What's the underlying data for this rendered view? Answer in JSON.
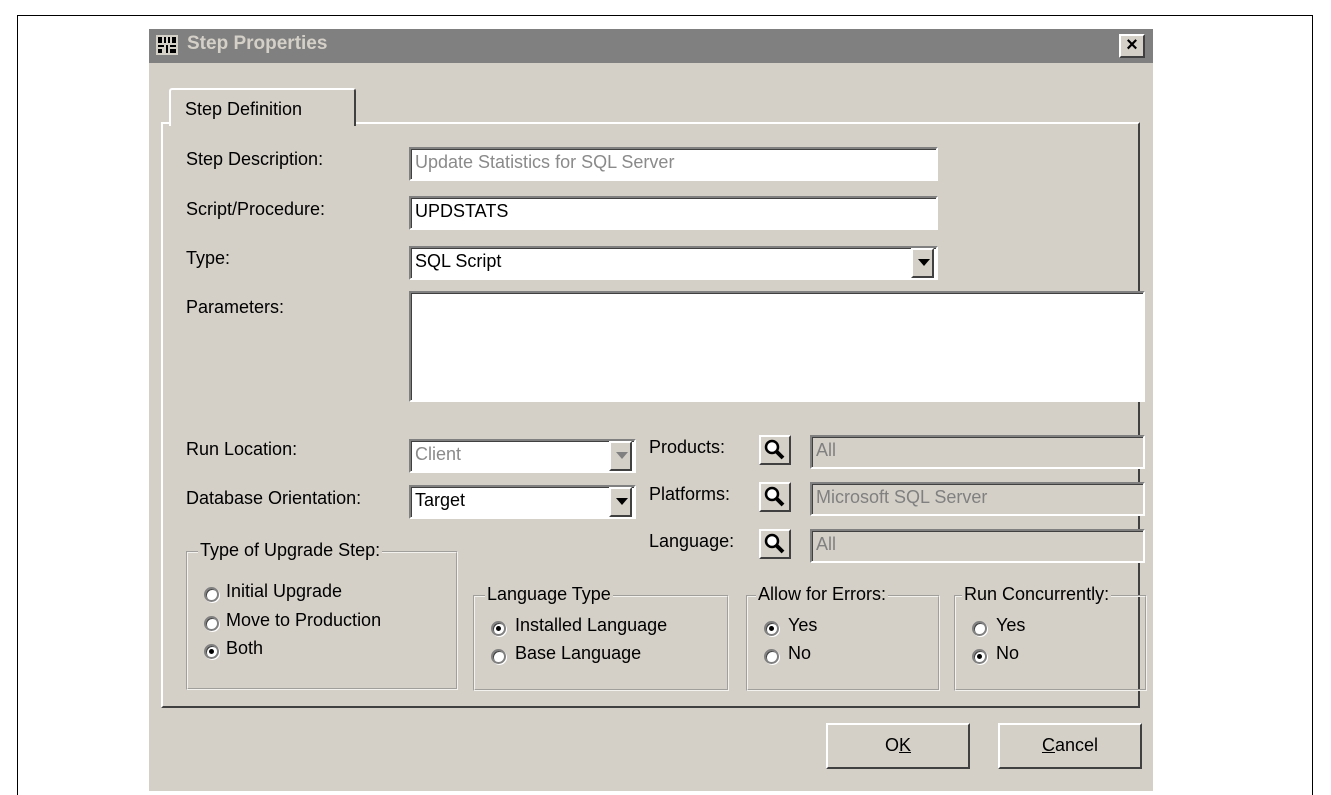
{
  "window": {
    "title": "Step Properties",
    "close_glyph": "×"
  },
  "tabs": [
    {
      "label": "Step Definition",
      "active": true
    }
  ],
  "fields": {
    "step_description": {
      "label": "Step Description:",
      "value": "Update Statistics for SQL Server"
    },
    "script_procedure": {
      "label": "Script/Procedure:",
      "value": "UPDSTATS"
    },
    "type": {
      "label": "Type:",
      "value": "SQL Script"
    },
    "parameters": {
      "label": "Parameters:",
      "value": ""
    },
    "run_location": {
      "label": "Run Location:",
      "value": "Client"
    },
    "database_orientation": {
      "label": "Database Orientation:",
      "value": "Target"
    },
    "products": {
      "label": "Products:",
      "value": "All"
    },
    "platforms": {
      "label": "Platforms:",
      "value": "Microsoft SQL Server"
    },
    "language": {
      "label": "Language:",
      "value": "All"
    }
  },
  "groups": {
    "upgrade_step": {
      "legend": "Type of Upgrade Step:",
      "options": [
        {
          "label": "Initial Upgrade",
          "checked": false
        },
        {
          "label": "Move to Production",
          "checked": false
        },
        {
          "label": "Both",
          "checked": true
        }
      ]
    },
    "language_type": {
      "legend": "Language Type",
      "options": [
        {
          "label": "Installed Language",
          "checked": true
        },
        {
          "label": "Base Language",
          "checked": false
        }
      ]
    },
    "allow_errors": {
      "legend": "Allow for Errors:",
      "options": [
        {
          "label": "Yes",
          "checked": true
        },
        {
          "label": "No",
          "checked": false
        }
      ]
    },
    "run_concurrently": {
      "legend": "Run Concurrently:",
      "options": [
        {
          "label": "Yes",
          "checked": false
        },
        {
          "label": "No",
          "checked": true
        }
      ]
    }
  },
  "buttons": {
    "ok": {
      "pre": "O",
      "hotkey": "K",
      "post": ""
    },
    "cancel": {
      "pre": "",
      "hotkey": "C",
      "post": "ancel"
    }
  },
  "icons": {
    "app": "app-logo-icon",
    "lookup": "magnifier-icon",
    "dropdown": "chevron-down-icon"
  },
  "colors": {
    "face": "#d4d0c8",
    "titlebar_inactive": "#808080",
    "disabled_text": "#8a8a8a"
  }
}
